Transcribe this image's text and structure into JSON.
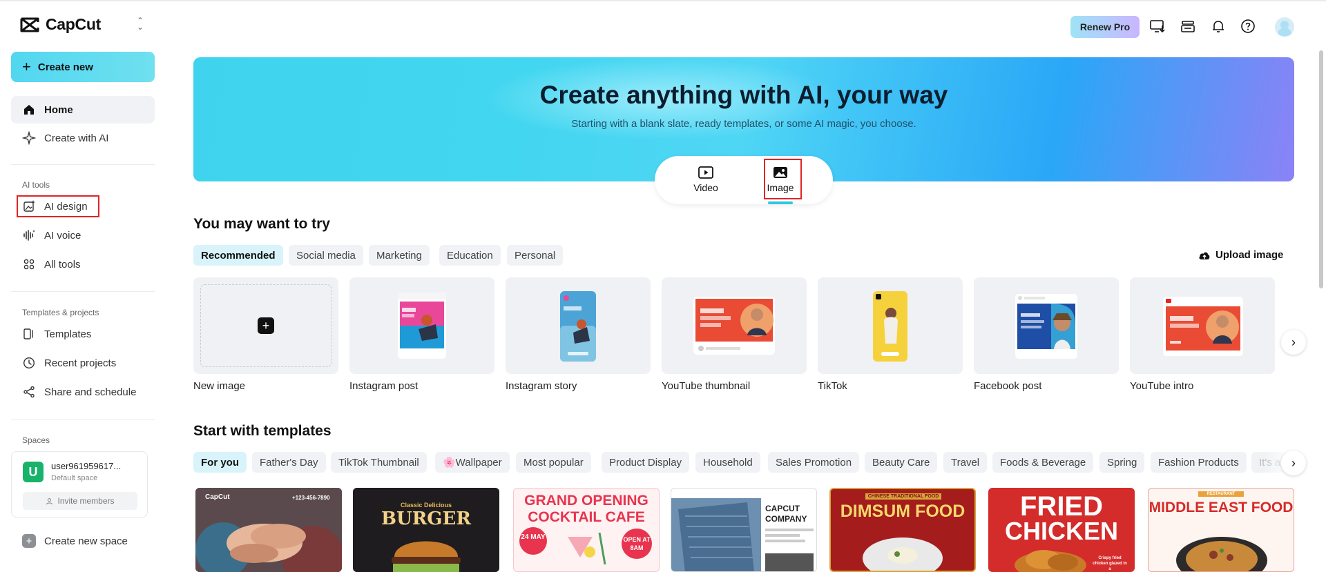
{
  "app": {
    "name": "CapCut"
  },
  "sidebar": {
    "create_new": "Create new",
    "home": "Home",
    "create_with_ai": "Create with AI",
    "ai_tools_label": "AI tools",
    "ai_design": "AI design",
    "ai_voice": "AI voice",
    "all_tools": "All tools",
    "templates_projects_label": "Templates & projects",
    "templates": "Templates",
    "recent_projects": "Recent projects",
    "share_schedule": "Share and schedule",
    "spaces_label": "Spaces",
    "space_user": "user961959617...",
    "space_sub": "Default space",
    "space_avatar_letter": "U",
    "invite_members": "Invite members",
    "create_new_space": "Create new space"
  },
  "header": {
    "renew_pro": "Renew Pro"
  },
  "hero": {
    "title": "Create anything with AI, your way",
    "subtitle": "Starting with a blank slate, ready templates, or some AI magic, you choose.",
    "video_tab": "Video",
    "image_tab": "Image"
  },
  "try_section": {
    "title": "You may want to try",
    "chips": [
      "Recommended",
      "Social media",
      "Marketing",
      "Education",
      "Personal"
    ],
    "upload_image": "Upload image",
    "cards": [
      "New image",
      "Instagram post",
      "Instagram story",
      "YouTube thumbnail",
      "TikTok",
      "Facebook post",
      "YouTube intro"
    ]
  },
  "templates_section": {
    "title": "Start with templates",
    "chips": [
      "For you",
      "Father's Day",
      "TikTok Thumbnail",
      "🌸Wallpaper",
      "Most popular",
      "Product Display",
      "Household",
      "Sales Promotion",
      "Beauty Care",
      "Travel",
      "Foods & Beverage",
      "Spring",
      "Fashion Products",
      "It's a"
    ],
    "tpl1_brand": "CapCut",
    "tpl1_phone": "+123-456-7890",
    "tpl2_kicker": "Classic Delicious",
    "tpl2_title": "BURGER",
    "tpl3_line1": "GRAND OPENING",
    "tpl3_line2": "COCKTAIL CAFE",
    "tpl3_date": "24 MAY",
    "tpl3_open": "OPEN AT 8AM",
    "tpl4_title": "CAPCUT COMPANY",
    "tpl5_kicker": "CHINESE TRADITIONAL FOOD",
    "tpl5_title": "DIMSUM FOOD",
    "tpl6_line1": "FRIED",
    "tpl6_line2": "CHICKEN",
    "tpl6_sub": "Crispy fried chicken glazed in a",
    "tpl7_kicker": "RESTAURANT",
    "tpl7_title": "MIDDLE EAST FOOD"
  },
  "colors": {
    "accent": "#2ec7e3",
    "highlight_box": "#e02424"
  }
}
